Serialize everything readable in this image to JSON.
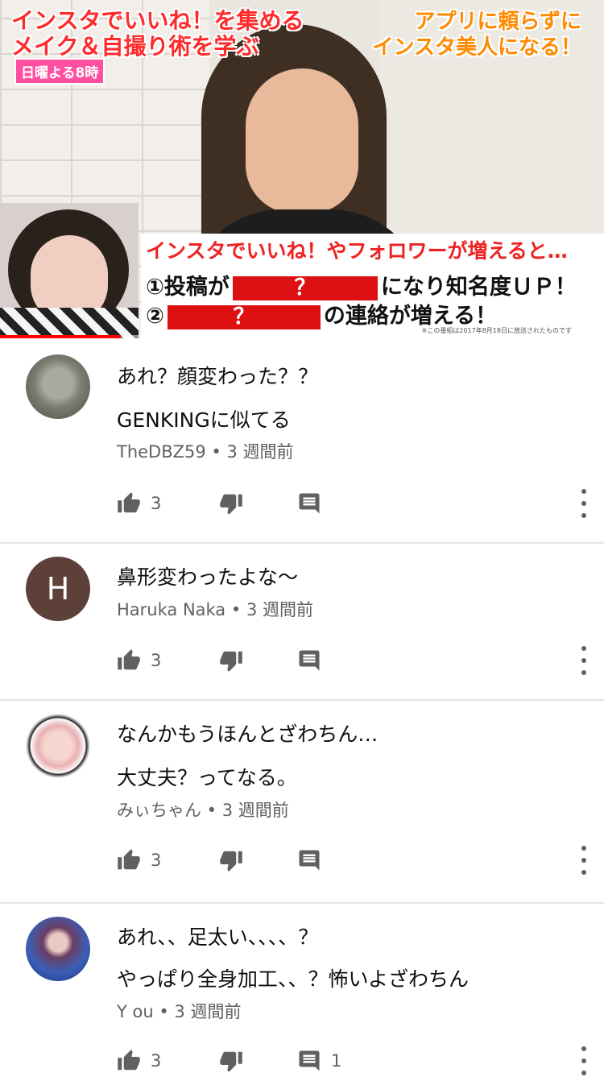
{
  "video": {
    "caption_top_left_1": "インスタでいいね！を集める",
    "caption_top_left_2": "メイク＆自撮り術を学ぶ",
    "schedule_tag": "日曜よる8時",
    "caption_top_right_1": "アプリに頼らずに",
    "caption_top_right_2": "インスタ美人になる！",
    "board_line1": "インスタでいいね！やフォロワーが増えると…",
    "board_line2_start": "①投稿が",
    "board_line2_box": "？",
    "board_line2_end": "になり知名度ＵＰ！",
    "board_line3_start": "②",
    "board_line3_box": "？",
    "board_line3_end": "の連絡が増える！",
    "board_note": "※この番組は2017年8月18日に放送されたものです",
    "progress": 0.2
  },
  "comments": [
    {
      "lines": [
        "あれ？顔変わった？？",
        "GENKINGに似てる"
      ],
      "author": "TheDBZ59",
      "time": "3 週間前",
      "likes": "3",
      "replies": ""
    },
    {
      "lines": [
        "鼻形変わったよな〜"
      ],
      "author": "Haruka Naka",
      "avatar_letter": "H",
      "time": "3 週間前",
      "likes": "3",
      "replies": ""
    },
    {
      "lines": [
        "なんかもうほんとざわちん…",
        "大丈夫？ってなる。"
      ],
      "author": "みぃちゃん",
      "time": "3 週間前",
      "likes": "3",
      "replies": ""
    },
    {
      "lines": [
        "あれ、、足太い、、、、？",
        "やっぱり全身加工、、？怖いよざわちん"
      ],
      "author": "Y ou",
      "time": "3 週間前",
      "likes": "3",
      "replies": "1"
    }
  ],
  "separator": " • ",
  "icons": {
    "like": "thumb-up-icon",
    "dislike": "thumb-down-icon",
    "reply": "comment-icon",
    "more": "more-vert-icon"
  },
  "colors": {
    "progress_red": "#ff0000",
    "meta_gray": "#606060",
    "avatar_brown": "#5d4037"
  }
}
